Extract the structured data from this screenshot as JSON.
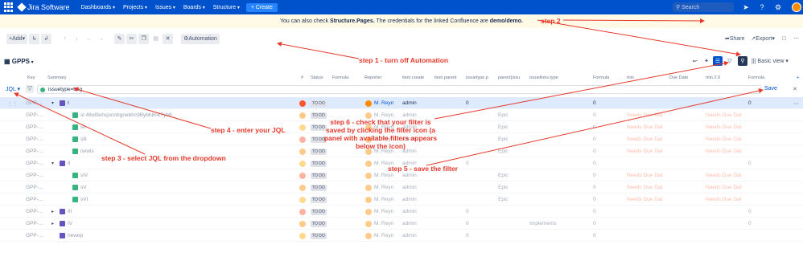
{
  "topnav": {
    "product": "Jira Software",
    "menu": [
      "Dashboards",
      "Projects",
      "Issues",
      "Boards",
      "Structure"
    ],
    "create_label": "+ Create",
    "search_placeholder": "Search"
  },
  "banner": {
    "prefix": "You can also check ",
    "pages": "Structure.Pages.",
    "middle": " The credentials for the linked Confluence are ",
    "creds": "demo/demo."
  },
  "toolbar": {
    "add_label": "Add",
    "automation_label": "Automation",
    "share_label": "Share",
    "export_label": "Export"
  },
  "view": {
    "structure_name": "GPPS",
    "basic_view_label": "Basic view"
  },
  "columns": [
    "Key",
    "Summary",
    "#",
    "Status",
    "Formula",
    "Reporter",
    "item.create",
    "item.parent",
    "issuetype.p",
    "parent(issu",
    "issuelinks.type",
    "Formula",
    "min",
    "Due Date",
    "min 2.0",
    "Formula"
  ],
  "filter": {
    "mode": "JQL",
    "query": "issuetype=bug",
    "save_label": "Save"
  },
  "rows": [
    {
      "key": "GPP-...",
      "summary": "I",
      "status": "TO DO",
      "reporter": "M. Reyn",
      "creator": "admin",
      "num0": "0",
      "epic": "",
      "impl": "",
      "f0": "0",
      "due1": "",
      "due2": "",
      "f3": "0"
    },
    {
      "key": "GPP-...",
      "summary": "sl 48ut9uhsjsnobgnebhc9Bybh8ne7yb8",
      "status": "TO DO",
      "reporter": "M. Reyn",
      "creator": "admin",
      "num0": "",
      "epic": "Epic",
      "impl": "",
      "f0": "0",
      "due1": "Needs Due Dat",
      "due2": "Needs Due Dat",
      "f3": ""
    },
    {
      "key": "GPP-...",
      "summary": "sll",
      "status": "TO DO",
      "reporter": "M. Reyn",
      "creator": "admin",
      "num0": "",
      "epic": "Epic",
      "impl": "",
      "f0": "0",
      "due1": "Needs Due Dat",
      "due2": "Needs Due Dat",
      "f3": ""
    },
    {
      "key": "GPP-...",
      "summary": "slll",
      "status": "TO DO",
      "reporter": "M. Reyn",
      "creator": "admin",
      "num0": "",
      "epic": "Epic",
      "impl": "",
      "f0": "0",
      "due1": "Needs Due Dat",
      "due2": "Needs Due Dat",
      "f3": ""
    },
    {
      "key": "GPP-...",
      "summary": "newis",
      "status": "TO DO",
      "reporter": "M. Reyn",
      "creator": "admin",
      "num0": "",
      "epic": "Epic",
      "impl": "",
      "f0": "0",
      "due1": "Needs Due Dat",
      "due2": "Needs Due Dat",
      "f3": ""
    },
    {
      "key": "GPP-...",
      "summary": "II",
      "status": "TO DO",
      "reporter": "M. Reyn",
      "creator": "admin",
      "num0": "0",
      "epic": "",
      "impl": "",
      "f0": "0",
      "due1": "",
      "due2": "",
      "f3": "0"
    },
    {
      "key": "GPP-...",
      "summary": "sIV",
      "status": "TO DO",
      "reporter": "M. Reyn",
      "creator": "admin",
      "num0": "",
      "epic": "Epic",
      "impl": "",
      "f0": "0",
      "due1": "Needs Due Dat",
      "due2": "Needs Due Dat",
      "f3": ""
    },
    {
      "key": "GPP-...",
      "summary": "sV",
      "status": "TO DO",
      "reporter": "M. Reyn",
      "creator": "admin",
      "num0": "",
      "epic": "Epic",
      "impl": "",
      "f0": "0",
      "due1": "Needs Due Dat",
      "due2": "Needs Due Dat",
      "f3": ""
    },
    {
      "key": "GPP-...",
      "summary": "sVI",
      "status": "TO DO",
      "reporter": "M. Reyn",
      "creator": "admin",
      "num0": "",
      "epic": "Epic",
      "impl": "",
      "f0": "0",
      "due1": "Needs Due Dat",
      "due2": "Needs Due Dat",
      "f3": ""
    },
    {
      "key": "GPP-...",
      "summary": "III",
      "status": "TO DO",
      "reporter": "M. Reyn",
      "creator": "admin",
      "num0": "0",
      "epic": "",
      "impl": "",
      "f0": "0",
      "due1": "",
      "due2": "",
      "f3": "0"
    },
    {
      "key": "GPP-...",
      "summary": "IV",
      "status": "TO DO",
      "reporter": "M. Reyn",
      "creator": "admin",
      "num0": "0",
      "epic": "",
      "impl": "Implements",
      "f0": "0",
      "due1": "",
      "due2": "",
      "f3": "0"
    },
    {
      "key": "GPP-...",
      "summary": "newep",
      "status": "TO DO",
      "reporter": "M. Reyn",
      "creator": "admin",
      "num0": "0",
      "epic": "",
      "impl": "",
      "f0": "0",
      "due1": "",
      "due2": "",
      "f3": ""
    }
  ],
  "annotations": {
    "step1": "step 1 - turn off Automation",
    "step2": "step 2",
    "step3": "step 3 - select JQL from the dropdown",
    "step4": "step 4 - enter your JQL",
    "step5": "step 5 - save the filter",
    "step6": "step 6 - check that your filter is saved by clicking the filter icon (a panel with available filters appears below the icon)"
  },
  "colors": {
    "nav": "#0052cc",
    "annotation": "#e5382b",
    "selected_row": "#deebff"
  }
}
